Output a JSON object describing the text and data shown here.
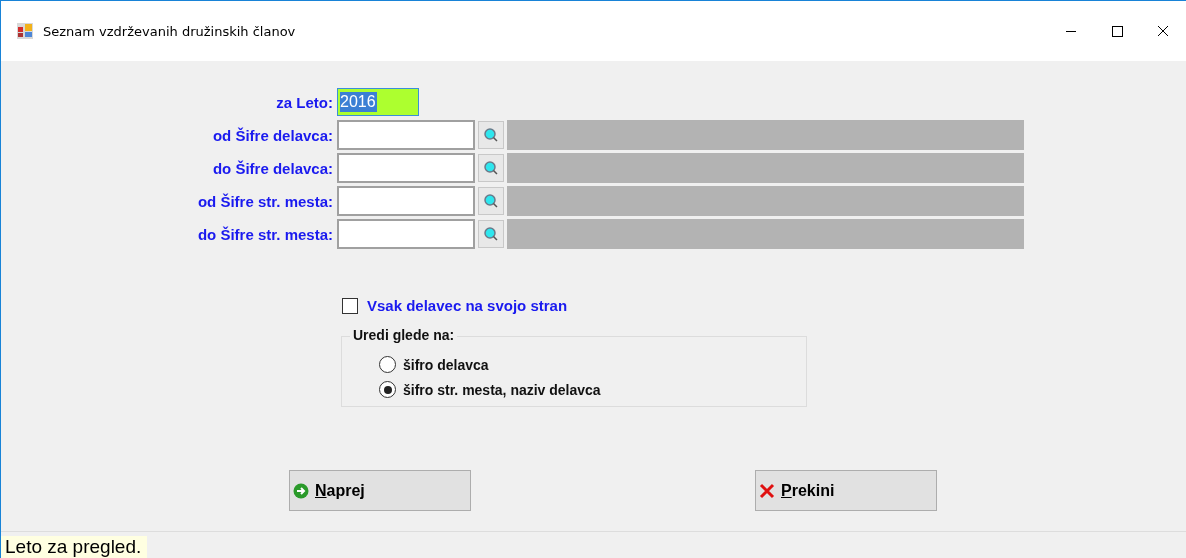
{
  "window": {
    "title": "Seznam vzdrževanih družinskih članov"
  },
  "year_field": {
    "label": "za Leto:",
    "value": "2016"
  },
  "range_fields": [
    {
      "label": "od Šifre delavca:"
    },
    {
      "label": "do Šifre delavca:"
    },
    {
      "label": "od Šifre str. mesta:"
    },
    {
      "label": "do Šifre str. mesta:"
    }
  ],
  "checkbox": {
    "label": "Vsak delavec na svojo stran",
    "checked": false
  },
  "sort_group": {
    "title": "Uredi glede na:",
    "options": [
      {
        "label": "šifro delavca",
        "selected": false
      },
      {
        "label": "šifro str. mesta, naziv delavca",
        "selected": true
      }
    ]
  },
  "buttons": [
    {
      "label": "Naprej",
      "kind": "forward"
    },
    {
      "label": "Prekini",
      "kind": "cancel"
    }
  ],
  "status_bar": {
    "text": "Leto za pregled."
  }
}
